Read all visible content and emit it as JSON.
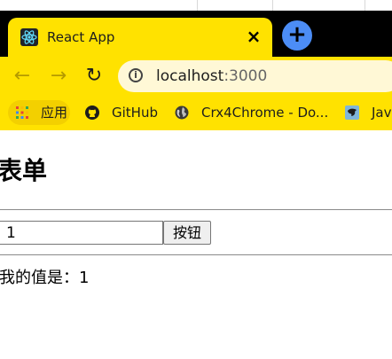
{
  "browser": {
    "tab": {
      "title": "React App",
      "icon": "react-icon"
    },
    "close_symbol": "×",
    "new_tab_symbol": "+",
    "nav": {
      "back": "←",
      "forward": "→",
      "reload": "↻"
    },
    "address": {
      "host": "localhost",
      "port": ":3000"
    },
    "bookmarks": [
      {
        "label": "应用",
        "icon": "apps-grid-icon"
      },
      {
        "label": "GitHub",
        "icon": "github-icon"
      },
      {
        "label": "Crx4Chrome - Do...",
        "icon": "globe-icon"
      },
      {
        "label": "Jav",
        "icon": "bird-icon"
      }
    ],
    "colors": {
      "accent": "#ffe200",
      "tabbar": "#000000",
      "newtab": "#4c8df6"
    }
  },
  "page": {
    "heading": "表单",
    "input_value": "1",
    "button_label": "按钮",
    "value_text": "我的值是：1"
  }
}
